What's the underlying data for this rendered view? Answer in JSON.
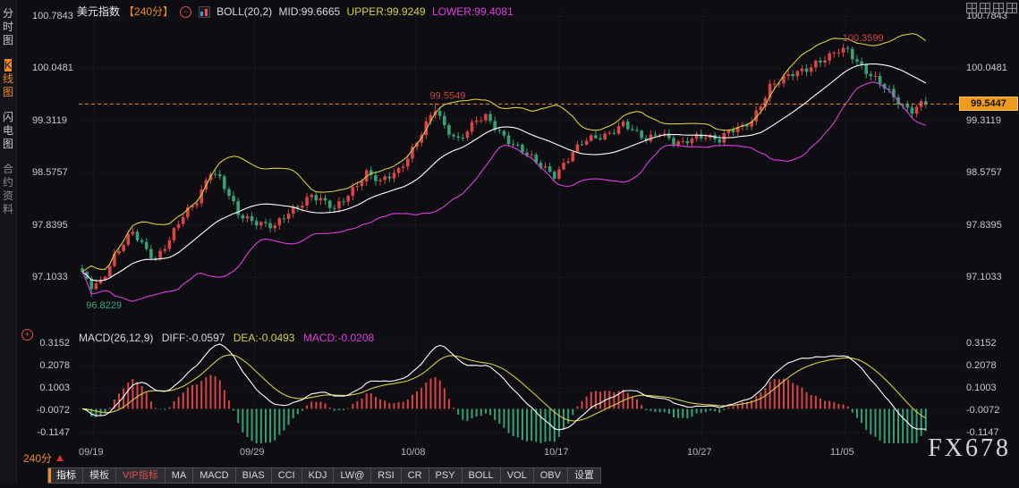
{
  "window": {
    "watermark": "FX678"
  },
  "sidebar": {
    "items": [
      {
        "label": "分时图",
        "key": "time-chart",
        "active": false
      },
      {
        "label": "K线图",
        "key": "kline-chart",
        "active": true
      },
      {
        "label": "闪电图",
        "key": "lightning-chart",
        "active": false
      },
      {
        "label": "合约资料",
        "key": "contract-info",
        "active": false
      }
    ]
  },
  "price_header": {
    "symbol": "美元指数",
    "period": "【240分】",
    "indicator": "BOLL(20,2)",
    "mid_label": "MID:99.6665",
    "upper_label": "UPPER:99.9249",
    "lower_label": "LOWER:99.4081"
  },
  "macd_header": {
    "indicator": "MACD(26,12,9)",
    "diff_label": "DIFF:-0.0597",
    "dea_label": "DEA:-0.0493",
    "macd_label": "MACD:-0.0208"
  },
  "period_selector": {
    "label": "240分"
  },
  "toolbar": {
    "items": [
      {
        "label": "指标",
        "key": "indicator",
        "active": true
      },
      {
        "label": "模板",
        "key": "template"
      },
      {
        "label": "VIP指标",
        "key": "vip-indicator",
        "color": "#e05050"
      },
      {
        "label": "MA",
        "key": "ma"
      },
      {
        "label": "MACD",
        "key": "macd"
      },
      {
        "label": "BIAS",
        "key": "bias"
      },
      {
        "label": "CCI",
        "key": "cci"
      },
      {
        "label": "KDJ",
        "key": "kdj"
      },
      {
        "label": "LW@",
        "key": "lwr"
      },
      {
        "label": "RSI",
        "key": "rsi"
      },
      {
        "label": "CR",
        "key": "cr"
      },
      {
        "label": "PSY",
        "key": "psy"
      },
      {
        "label": "BOLL",
        "key": "boll"
      },
      {
        "label": "VOL",
        "key": "vol"
      },
      {
        "label": "OBV",
        "key": "obv"
      },
      {
        "label": "设置",
        "key": "settings"
      }
    ]
  },
  "chart_data": {
    "type": "candlestick",
    "title": "美元指数 240分 K线图 + BOLL(20,2) + MACD(26,12,9)",
    "x_tick_labels": [
      "09/19",
      "09/29",
      "10/08",
      "10/17",
      "10/27",
      "11/05"
    ],
    "price_axis_ticks": [
      "100.7843",
      "100.0481",
      "99.3119",
      "98.5757",
      "97.8395",
      "97.1033"
    ],
    "macd_axis_ticks": [
      "0.3152",
      "0.2078",
      "0.1003",
      "-0.0072",
      "-0.1147"
    ],
    "bar_count": 185,
    "current_price": "99.5447",
    "boll": {
      "period": 20,
      "mult": 2,
      "mid": 99.6665,
      "upper": 99.9249,
      "lower": 99.4081
    },
    "macd": {
      "fast": 12,
      "slow": 26,
      "signal": 9,
      "diff": -0.0597,
      "dea": -0.0493,
      "macd": -0.0208
    },
    "close_anchors": [
      [
        0,
        97.12
      ],
      [
        2,
        96.98
      ],
      [
        4,
        97.06
      ],
      [
        7,
        97.4
      ],
      [
        11,
        97.72
      ],
      [
        14,
        97.5
      ],
      [
        16,
        97.38
      ],
      [
        19,
        97.62
      ],
      [
        22,
        97.95
      ],
      [
        25,
        98.2
      ],
      [
        28,
        98.62
      ],
      [
        30,
        98.48
      ],
      [
        34,
        97.98
      ],
      [
        38,
        97.9
      ],
      [
        42,
        97.8
      ],
      [
        46,
        98.06
      ],
      [
        50,
        98.28
      ],
      [
        55,
        98.04
      ],
      [
        59,
        98.36
      ],
      [
        62,
        98.58
      ],
      [
        65,
        98.42
      ],
      [
        69,
        98.62
      ],
      [
        73,
        99.02
      ],
      [
        77,
        99.46
      ],
      [
        79,
        99.22
      ],
      [
        82,
        99.06
      ],
      [
        86,
        99.3
      ],
      [
        88,
        99.34
      ],
      [
        92,
        99.1
      ],
      [
        95,
        98.94
      ],
      [
        99,
        98.7
      ],
      [
        103,
        98.56
      ],
      [
        107,
        98.86
      ],
      [
        110,
        99.02
      ],
      [
        114,
        99.12
      ],
      [
        118,
        99.26
      ],
      [
        121,
        99.1
      ],
      [
        123,
        99.04
      ],
      [
        126,
        99.18
      ],
      [
        129,
        99.0
      ],
      [
        131,
        98.96
      ],
      [
        134,
        99.08
      ],
      [
        136,
        99.12
      ],
      [
        139,
        99.05
      ],
      [
        141,
        99.14
      ],
      [
        144,
        99.2
      ],
      [
        146,
        99.32
      ],
      [
        148,
        99.56
      ],
      [
        150,
        99.8
      ],
      [
        153,
        99.88
      ],
      [
        155,
        99.96
      ],
      [
        158,
        100.06
      ],
      [
        160,
        100.14
      ],
      [
        163,
        100.2
      ],
      [
        165,
        100.28
      ],
      [
        167,
        100.3
      ],
      [
        169,
        100.16
      ],
      [
        172,
        99.96
      ],
      [
        175,
        99.76
      ],
      [
        177,
        99.62
      ],
      [
        179,
        99.52
      ],
      [
        181,
        99.48
      ],
      [
        183,
        99.56
      ],
      [
        184,
        99.5447
      ]
    ],
    "pins": {
      "low": [
        2,
        96.8229
      ],
      "highs": [
        [
          77,
          99.5549
        ],
        [
          167,
          100.3599
        ]
      ]
    },
    "annotations": [
      {
        "index": 77,
        "text": "99.5549",
        "position": "above",
        "color": "#d04545"
      },
      {
        "index": 167,
        "text": "100.3599",
        "position": "above",
        "color": "#d04545"
      },
      {
        "index": 2,
        "text": "96.8229",
        "position": "below",
        "color": "#3aa578"
      }
    ],
    "colors": {
      "up": "#d94444",
      "down": "#35a178",
      "boll_mid": "#ffffff",
      "boll_upper": "#d6cf3e",
      "boll_lower": "#df3edf",
      "diff_line": "#ffffff",
      "dea_line": "#d6cf3e",
      "grid": "#2b2b35",
      "axis_text": "#c9c9cf",
      "accent_orange": "#f08c1e",
      "current_price_bg": "#ef9a1d"
    }
  }
}
